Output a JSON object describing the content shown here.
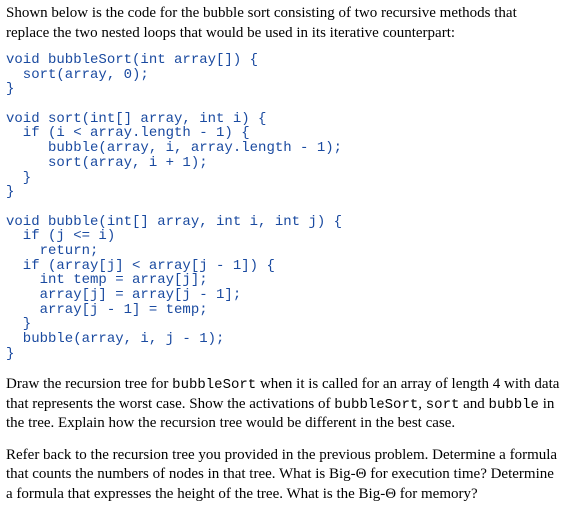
{
  "intro": "Shown below is the code for the bubble sort consisting of two recursive methods that replace the two nested loops that would be used in its iterative counterpart:",
  "code": "void bubbleSort(int array[]) {\n  sort(array, 0);\n}\n\nvoid sort(int[] array, int i) {\n  if (i < array.length - 1) {\n     bubble(array, i, array.length - 1);\n     sort(array, i + 1);\n  }\n}\n\nvoid bubble(int[] array, int i, int j) {\n  if (j <= i)\n    return;\n  if (array[j] < array[j - 1]) {\n    int temp = array[j];\n    array[j] = array[j - 1];\n    array[j - 1] = temp;\n  }\n  bubble(array, i, j - 1);\n}",
  "q1": {
    "part1": "Draw the recursion tree for ",
    "mono1": "bubbleSort",
    "part2": " when it is called for an array of length 4 with data that represents the worst case. Show the activations of ",
    "mono2": "bubbleSort",
    "part3": ", ",
    "mono3": "sort",
    "part4": " and ",
    "mono4": "bubble",
    "part5": " in the tree. Explain how the recursion tree would be different in the best case."
  },
  "q2": "Refer back to the recursion tree you provided in the previous problem. Determine a formula that counts the numbers of nodes in that tree. What is Big-Θ for execution time? Determine a formula that expresses the height of the tree. What is the Big-Θ for memory?"
}
